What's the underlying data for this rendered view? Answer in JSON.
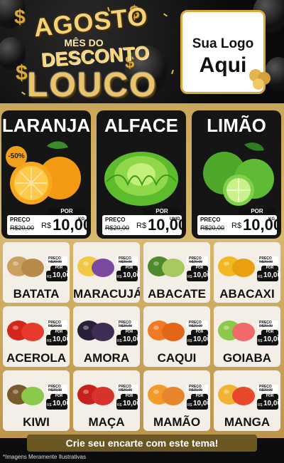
{
  "header": {
    "line1": "AGOSTO",
    "line2": "MÊS DO",
    "line3": "DESCONTO",
    "line4": "LOUCO",
    "logo_line1": "Sua Logo",
    "logo_line2": "Aqui"
  },
  "featured": [
    {
      "name": "LARANJA",
      "badge": "-50%",
      "preco_label": "PREÇO",
      "old": "R$20,00",
      "por_label": "POR",
      "currency": "R$",
      "price": "10,00",
      "unit": "KG"
    },
    {
      "name": "ALFACE",
      "preco_label": "PREÇO",
      "old": "R$20,00",
      "por_label": "POR",
      "currency": "R$",
      "price": "10,00",
      "unit": "UNID"
    },
    {
      "name": "LIMÃO",
      "preco_label": "PREÇO",
      "old": "R$20,00",
      "por_label": "POR",
      "currency": "R$",
      "price": "10,00",
      "unit": "KG"
    }
  ],
  "small_tag": {
    "preco_label": "PREÇO",
    "old": "R$20,00",
    "por_label": "POR",
    "currency": "R$",
    "price": "10,00",
    "unit": "KG"
  },
  "products": [
    {
      "name": "BATATA"
    },
    {
      "name": "MARACUJÁ"
    },
    {
      "name": "ABACATE"
    },
    {
      "name": "ABACAXI"
    },
    {
      "name": "ACEROLA"
    },
    {
      "name": "AMORA"
    },
    {
      "name": "CAQUI"
    },
    {
      "name": "GOIABA"
    },
    {
      "name": "KIWI"
    },
    {
      "name": "MAÇA"
    },
    {
      "name": "MAMÃO"
    },
    {
      "name": "MANGA"
    }
  ],
  "footer": {
    "cta": "Crie seu encarte com este tema!",
    "disclaimer": "*Imagens Meramente Ilustrativas"
  },
  "colors": {
    "gold": "#d8b86e",
    "dark": "#151515",
    "accent": "#f0a11c"
  }
}
